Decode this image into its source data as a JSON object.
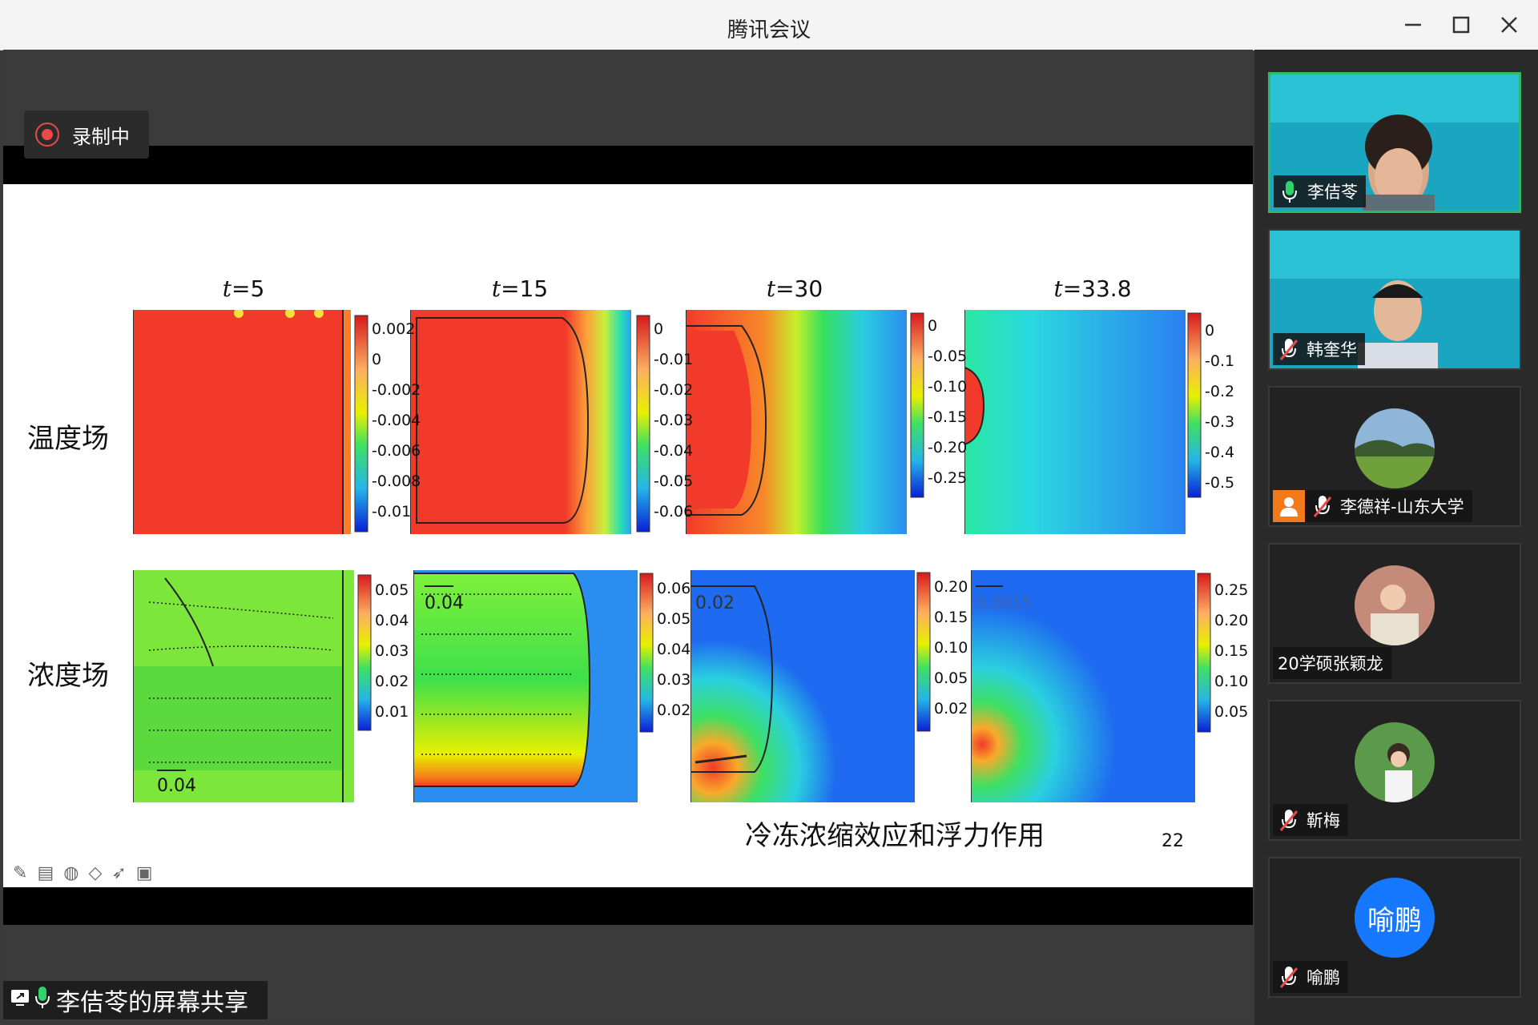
{
  "window": {
    "title": "腾讯会议"
  },
  "recording": {
    "label": "录制中"
  },
  "share": {
    "label": "李佶苓的屏幕共享"
  },
  "slide": {
    "row_labels": [
      "温度场",
      "浓度场"
    ],
    "caption": "冷冻浓缩效应和浮力作用",
    "page_number": "22",
    "panel_titles": [
      {
        "var": "t",
        "value": "=5"
      },
      {
        "var": "t",
        "value": "=15"
      },
      {
        "var": "t",
        "value": "=30"
      },
      {
        "var": "t",
        "value": "=33.8"
      }
    ],
    "temperature_colorbars": [
      [
        "0.002",
        "0",
        "-0.002",
        "-0.004",
        "-0.006",
        "-0.008",
        "-0.01"
      ],
      [
        "0",
        "-0.01",
        "-0.02",
        "-0.03",
        "-0.04",
        "-0.05",
        "-0.06"
      ],
      [
        "0",
        "-0.05",
        "-0.10",
        "-0.15",
        "-0.20",
        "-0.25"
      ],
      [
        "0",
        "-0.1",
        "-0.2",
        "-0.3",
        "-0.4",
        "-0.5"
      ]
    ],
    "concentration_colorbars": [
      [
        "0.05",
        "0.04",
        "0.03",
        "0.02",
        "0.01"
      ],
      [
        "0.06",
        "0.05",
        "0.04",
        "0.03",
        "0.02"
      ],
      [
        "0.20",
        "0.15",
        "0.10",
        "0.05",
        "0.02"
      ],
      [
        "0.25",
        "0.20",
        "0.15",
        "0.10",
        "0.05"
      ]
    ],
    "vector_scales": [
      "0.04",
      "0.04",
      "0.02",
      "0.0015"
    ]
  },
  "participants": [
    {
      "name": "李佶苓",
      "mic": "on",
      "type": "video",
      "active": true
    },
    {
      "name": "韩奎华",
      "mic": "muted",
      "type": "video",
      "active": false
    },
    {
      "name": "李德祥-山东大学",
      "mic": "muted",
      "type": "avatar",
      "active": false
    },
    {
      "name": "20学硕张颖龙",
      "mic": "none",
      "type": "avatar",
      "active": false
    },
    {
      "name": "靳梅",
      "mic": "muted",
      "type": "avatar",
      "active": false
    },
    {
      "name": "喻鹏",
      "mic": "muted",
      "type": "text-avatar",
      "avatar_text": "喻鹏",
      "active": false
    }
  ],
  "icons": {
    "minimize": "minimize-icon",
    "maximize": "maximize-icon",
    "close": "close-icon",
    "record": "record-icon",
    "mic_on": "mic-icon",
    "mic_muted": "mic-muted-icon",
    "screen_share": "screen-share-icon"
  },
  "colors": {
    "active_speaker": "#2fb86a",
    "record_red": "#e84a4a",
    "avatar_blue": "#1677ff"
  }
}
